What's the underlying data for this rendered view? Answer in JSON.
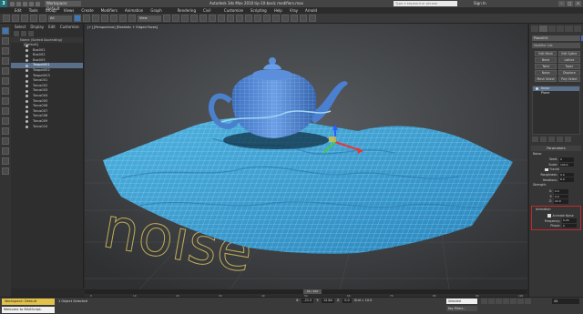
{
  "titlebar": {
    "logo": "3",
    "workspace": "Workspace: Default",
    "title": "Autodesk 3ds Max 2016    tip-10-basic modifiers.max",
    "search_placeholder": "Type a keyword or phrase",
    "signin": "Sign In"
  },
  "menu": [
    "Edit",
    "Tools",
    "Group",
    "Views",
    "Create",
    "Modifiers",
    "Animation",
    "Graph Editors",
    "Rendering",
    "Civil View",
    "Customize",
    "Scripting",
    "Help",
    "Vray",
    "Arnold"
  ],
  "toolbar": {
    "filter": "All",
    "view_dropdown": "View"
  },
  "scene_explorer": {
    "tabs": [
      "Select",
      "Display",
      "Edit",
      "Customize"
    ],
    "column_header": "Name (Sorted Ascending)",
    "root": "[Default]",
    "items": [
      "Box001",
      "Box002",
      "Box003",
      "Teapot001",
      "Teapot002",
      "Teapot003",
      "Torus001",
      "Torus002",
      "Torus003",
      "Torus004",
      "Torus005",
      "Torus006",
      "Torus007",
      "Torus008",
      "Torus009",
      "Torus010"
    ],
    "selected_index": 3
  },
  "viewport": {
    "label": "[+] [Perspective] [Realistic + Edged Faces]",
    "floor_text": "noise"
  },
  "command_panel": {
    "object_name": "Plane001",
    "modifier_list": "Modifier List",
    "buttons": [
      "Edit Mesh",
      "Edit Spline",
      "Bend",
      "Lattice",
      "Twist",
      "Taper",
      "Noise",
      "Displace",
      "Mesh Select",
      "Poly Select"
    ],
    "stack": [
      "Noise",
      "Plane"
    ],
    "stack_selected": 0,
    "parameters_title": "Parameters",
    "noise_section": "Noise:",
    "seed_label": "Seed:",
    "seed": "0",
    "scale_label": "Scale:",
    "scale": "100.0",
    "fractal_label": "Fractal",
    "roughness_label": "Roughness:",
    "roughness": "0.0",
    "iterations_label": "Iterations:",
    "iterations": "6.0",
    "strength_section": "Strength:",
    "x_label": "X:",
    "x": "0.0",
    "y_label": "Y:",
    "y": "0.0",
    "z_label": "Z:",
    "z": "22.0",
    "animation_section": "Animation:",
    "animate_noise_label": "Animate Noise",
    "frequency_label": "Frequency:",
    "frequency": "0.25",
    "phase_label": "Phase:",
    "phase": "0"
  },
  "timeline": {
    "current": "44 / 100",
    "ticks": [
      "0",
      "10",
      "20",
      "30",
      "40",
      "50",
      "60",
      "70",
      "80",
      "90",
      "100"
    ]
  },
  "status": {
    "workspace": "Workspace: Default",
    "listener": "Welcome to MAXScript.",
    "selected": "1 Object Selected",
    "x_label": "X:",
    "x": "-21.5",
    "y_label": "Y:",
    "y": "12.84",
    "z_label": "Z:",
    "z": "0.0",
    "grid": "Grid = 10.0",
    "set_key": "Selected",
    "key_filters": "Key Filters...",
    "frame": "44"
  }
}
